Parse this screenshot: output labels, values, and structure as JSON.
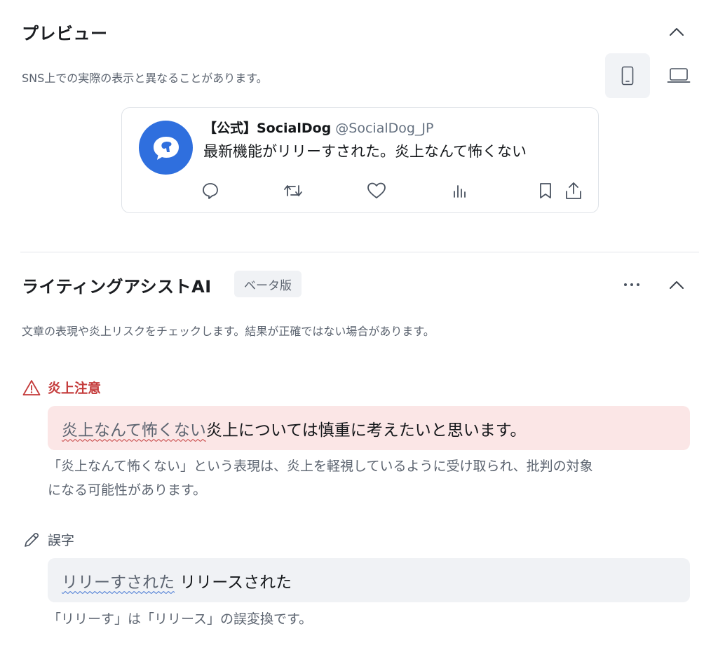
{
  "preview": {
    "title": "プレビュー",
    "subtitle": "SNS上での実際の表示と異なることがあります。",
    "collapse_icon": "chevron-up-icon",
    "device_mobile_icon": "mobile-icon",
    "device_desktop_icon": "laptop-icon",
    "tweet": {
      "name": "【公式】SocialDog",
      "handle": "@SocialDog_JP",
      "text": "最新機能がリリーすされた。炎上なんて怖くない",
      "actions": [
        "reply-icon",
        "retweet-icon",
        "like-icon",
        "views-icon",
        "bookmark-icon",
        "share-icon"
      ]
    }
  },
  "assist": {
    "title": "ライティングアシストAI",
    "badge": "ベータ版",
    "subtitle": "文章の表現や炎上リスクをチェックします。結果が正確ではない場合があります。",
    "issues": [
      {
        "label": "炎上注意",
        "flagged": "炎上なんて怖くない",
        "rest": "炎上については慎重に考えたいと思います。",
        "explanation_line1": "「炎上なんて怖くない」という表現は、炎上を軽視しているように受け取られ、批判の対象",
        "explanation_line2": "になる可能性があります。"
      },
      {
        "label": "誤字",
        "flagged": "リリーすされた",
        "rest": " リリースされた",
        "explanation_line1": "「リリーす」は「リリース」の誤変換です。"
      }
    ]
  },
  "colors": {
    "brand": "#2f6fde",
    "warning": "#c43a3a",
    "warning_bg": "#fbe6e6",
    "neutral_bg": "#f0f2f5"
  }
}
